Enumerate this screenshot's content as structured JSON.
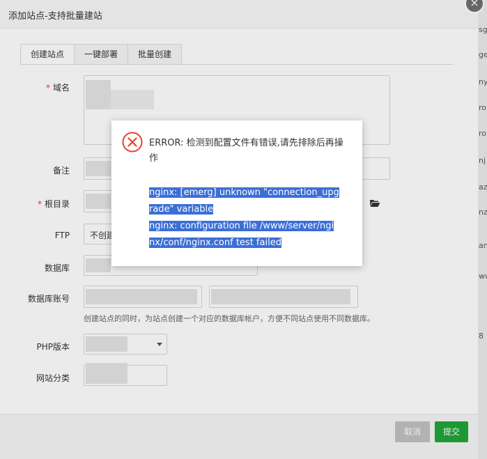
{
  "background": {
    "side_fragments": [
      "sg",
      "ge",
      "ny",
      "ro",
      "ro",
      "nj",
      "az",
      "nz",
      "an",
      "ww",
      "8"
    ]
  },
  "dialog": {
    "title": "添加站点-支持批量建站",
    "close": "×",
    "tabs": [
      {
        "label": "创建站点",
        "active": true
      },
      {
        "label": "一键部署",
        "active": false
      },
      {
        "label": "批量创建",
        "active": false
      }
    ],
    "form": {
      "domain_label": "域名",
      "remark_label": "备注",
      "root_label": "根目录",
      "ftp_label": "FTP",
      "ftp_value": "不创建",
      "database_label": "数据库",
      "db_account_label": "数据库账号",
      "db_hint": "创建站点的同时，为站点创建一个对应的数据库帐户，方便不同站点使用不同数据库。",
      "php_label": "PHP版本",
      "category_label": "网站分类",
      "required_mark": "*"
    },
    "footer": {
      "cancel_label": "取消",
      "submit_label": "提交"
    }
  },
  "error_popup": {
    "title": "ERROR: 检测到配置文件有错误,请先排除后再操作",
    "lines": [
      "nginx: [emerg] unknown \"connection_upg",
      "rade\" variable",
      "nginx: configuration file /www/server/ngi",
      "nx/conf/nginx.conf test failed"
    ]
  },
  "colors": {
    "accent_green": "#20a53a",
    "cancel_gray": "#c2c2c2",
    "error_red": "#e8422f",
    "selection_blue": "#3b6fd6"
  }
}
